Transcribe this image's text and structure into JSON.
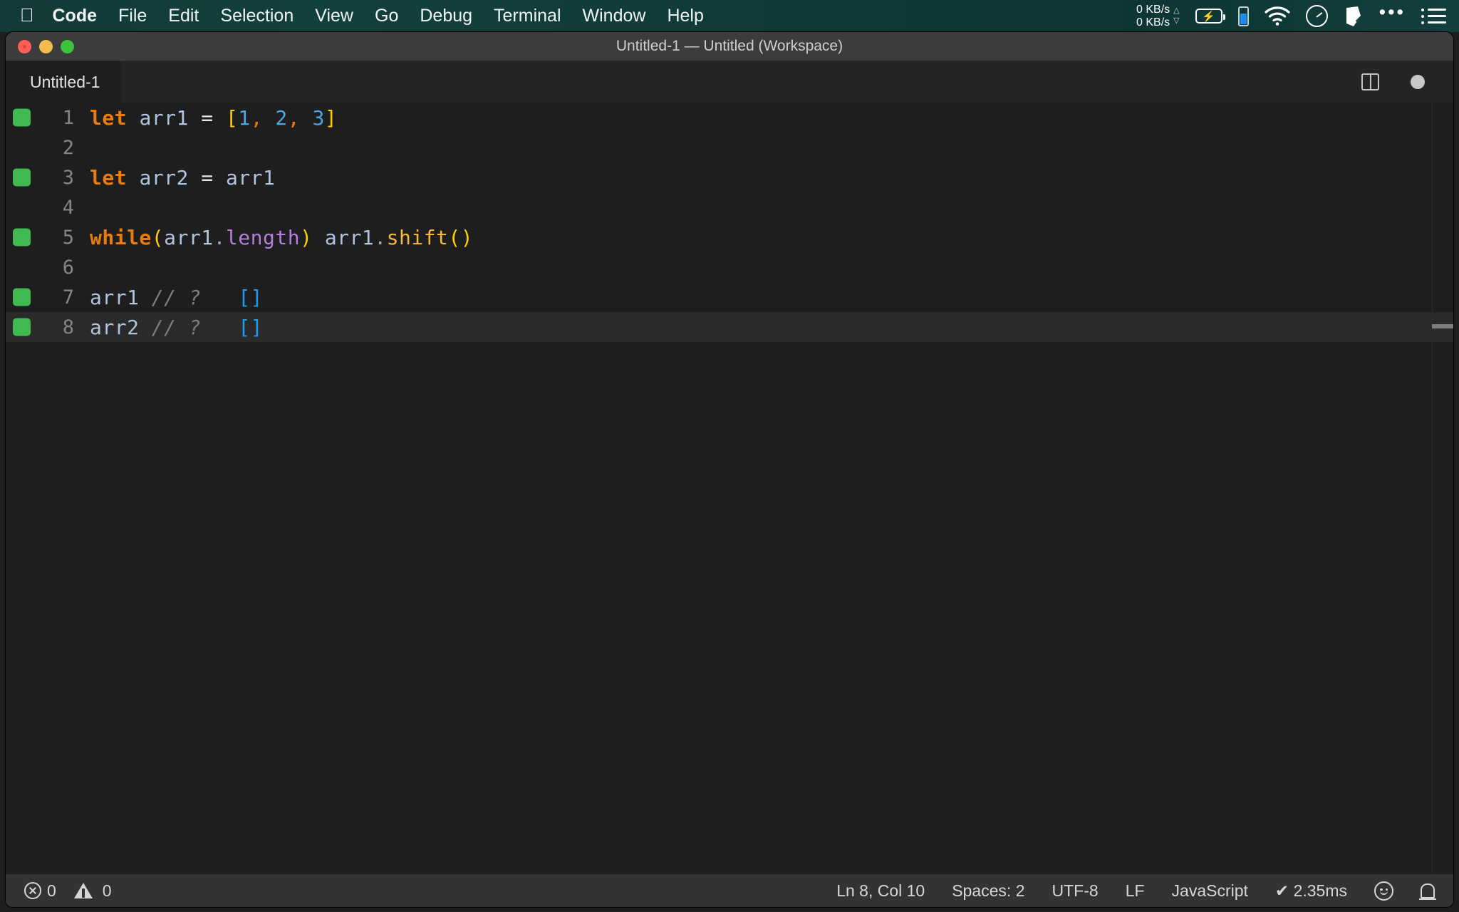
{
  "menubar": {
    "apple_icon": "apple-logo",
    "items": [
      {
        "label": "Code",
        "bold": true
      },
      {
        "label": "File",
        "bold": false
      },
      {
        "label": "Edit",
        "bold": false
      },
      {
        "label": "Selection",
        "bold": false
      },
      {
        "label": "View",
        "bold": false
      },
      {
        "label": "Go",
        "bold": false
      },
      {
        "label": "Debug",
        "bold": false
      },
      {
        "label": "Terminal",
        "bold": false
      },
      {
        "label": "Window",
        "bold": false
      },
      {
        "label": "Help",
        "bold": false
      }
    ],
    "status": {
      "net_up": "0 KB/s",
      "net_down": "0 KB/s",
      "up_arrow": "△",
      "down_arrow": "▽",
      "icons": [
        "battery-charging-icon",
        "battery-level-icon",
        "wifi-icon",
        "clock-icon",
        "dropbox-icon",
        "ellipsis-icon",
        "list-menu-icon"
      ]
    }
  },
  "window": {
    "title": "Untitled-1 — Untitled (Workspace)",
    "traffic_lights": [
      "close-button",
      "minimize-button",
      "zoom-button"
    ]
  },
  "tabbar": {
    "tabs": [
      {
        "label": "Untitled-1",
        "active": true
      }
    ],
    "actions": [
      "split-editor-icon",
      "unsaved-indicator-dot"
    ]
  },
  "editor": {
    "language": "javascript",
    "lines": [
      {
        "number": "1",
        "coverage": true,
        "current": false,
        "tokens": [
          {
            "text": "let",
            "cls": "kw"
          },
          {
            "text": " ",
            "cls": "op"
          },
          {
            "text": "arr1",
            "cls": "var"
          },
          {
            "text": " ",
            "cls": "op"
          },
          {
            "text": "=",
            "cls": "op"
          },
          {
            "text": " ",
            "cls": "op"
          },
          {
            "text": "[",
            "cls": "brk"
          },
          {
            "text": "1",
            "cls": "num"
          },
          {
            "text": ",",
            "cls": "comma"
          },
          {
            "text": " ",
            "cls": "op"
          },
          {
            "text": "2",
            "cls": "num"
          },
          {
            "text": ",",
            "cls": "comma"
          },
          {
            "text": " ",
            "cls": "op"
          },
          {
            "text": "3",
            "cls": "num"
          },
          {
            "text": "]",
            "cls": "brk"
          }
        ]
      },
      {
        "number": "2",
        "coverage": false,
        "current": false,
        "tokens": []
      },
      {
        "number": "3",
        "coverage": true,
        "current": false,
        "tokens": [
          {
            "text": "let",
            "cls": "kw"
          },
          {
            "text": " ",
            "cls": "op"
          },
          {
            "text": "arr2",
            "cls": "var"
          },
          {
            "text": " ",
            "cls": "op"
          },
          {
            "text": "=",
            "cls": "op"
          },
          {
            "text": " ",
            "cls": "op"
          },
          {
            "text": "arr1",
            "cls": "var"
          }
        ]
      },
      {
        "number": "4",
        "coverage": false,
        "current": false,
        "tokens": []
      },
      {
        "number": "5",
        "coverage": true,
        "current": false,
        "tokens": [
          {
            "text": "while",
            "cls": "kw"
          },
          {
            "text": "(",
            "cls": "brk"
          },
          {
            "text": "arr1",
            "cls": "var"
          },
          {
            "text": ".",
            "cls": "dot"
          },
          {
            "text": "length",
            "cls": "prop"
          },
          {
            "text": ")",
            "cls": "brk"
          },
          {
            "text": " ",
            "cls": "op"
          },
          {
            "text": "arr1",
            "cls": "var"
          },
          {
            "text": ".",
            "cls": "dot"
          },
          {
            "text": "shift",
            "cls": "fn"
          },
          {
            "text": "()",
            "cls": "brk"
          }
        ]
      },
      {
        "number": "6",
        "coverage": false,
        "current": false,
        "tokens": []
      },
      {
        "number": "7",
        "coverage": true,
        "current": false,
        "tokens": [
          {
            "text": "arr1",
            "cls": "var"
          },
          {
            "text": " ",
            "cls": "op"
          },
          {
            "text": "// ?",
            "cls": "cmt"
          },
          {
            "text": "   ",
            "cls": "op"
          },
          {
            "text": "[]",
            "cls": "res"
          }
        ]
      },
      {
        "number": "8",
        "coverage": true,
        "current": true,
        "tokens": [
          {
            "text": "arr2",
            "cls": "var"
          },
          {
            "text": " ",
            "cls": "op"
          },
          {
            "text": "// ?",
            "cls": "cmt"
          },
          {
            "text": "   ",
            "cls": "op"
          },
          {
            "text": "[]",
            "cls": "res"
          }
        ]
      }
    ]
  },
  "statusbar": {
    "errors": "0",
    "warnings": "0",
    "position": "Ln 8, Col 10",
    "indentation": "Spaces: 2",
    "encoding": "UTF-8",
    "eol": "LF",
    "language": "JavaScript",
    "runtime": "✔ 2.35ms",
    "feedback_icon": "smiley-icon",
    "notifications_icon": "bell-icon"
  },
  "colors": {
    "menubar_bg": "#123a38",
    "titlebar_bg": "#3c3c3c",
    "editor_bg": "#1e1e1e",
    "tabbar_bg": "#252526",
    "statusbar_bg": "#333333",
    "coverage_green": "#3fb950",
    "keyword_orange": "#e87d0d",
    "bracket_yellow": "#ffd000",
    "number_blue": "#4aa5e0",
    "property_purple": "#b57edc",
    "function_gold": "#f5b942",
    "result_blue": "#1e9cf0",
    "comment_gray": "#7d7d7d"
  }
}
